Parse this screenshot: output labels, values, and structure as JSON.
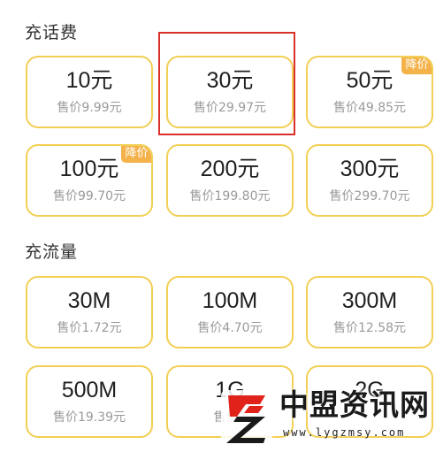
{
  "sections": {
    "recharge": {
      "title": "充话费",
      "items": [
        {
          "amount": "10元",
          "price": "售价9.99元"
        },
        {
          "amount": "30元",
          "price": "售价29.97元"
        },
        {
          "amount": "50元",
          "price": "售价49.85元",
          "badge": "降价"
        },
        {
          "amount": "100元",
          "price": "售价99.70元",
          "badge": "降价"
        },
        {
          "amount": "200元",
          "price": "售价199.80元"
        },
        {
          "amount": "300元",
          "price": "售价299.70元"
        }
      ]
    },
    "data": {
      "title": "充流量",
      "items": [
        {
          "amount": "30M",
          "price": "售价1.72元"
        },
        {
          "amount": "100M",
          "price": "售价4.70元"
        },
        {
          "amount": "300M",
          "price": "售价12.58元"
        },
        {
          "amount": "500M",
          "price": "售价19.39元"
        },
        {
          "amount": "1G",
          "price": "售价2"
        },
        {
          "amount": "2G",
          "price": ""
        }
      ]
    }
  },
  "selected_item": "30元",
  "watermark": {
    "brand": "中盟资讯网",
    "url": "www.lygzmsy.com",
    "logo_icon": "stylized-z-logo-icon"
  },
  "colors": {
    "card_border": "#f2cf55",
    "badge_bg": "#f4b24a",
    "selection_outline": "#d9302c",
    "logo_red": "#e0221b"
  }
}
